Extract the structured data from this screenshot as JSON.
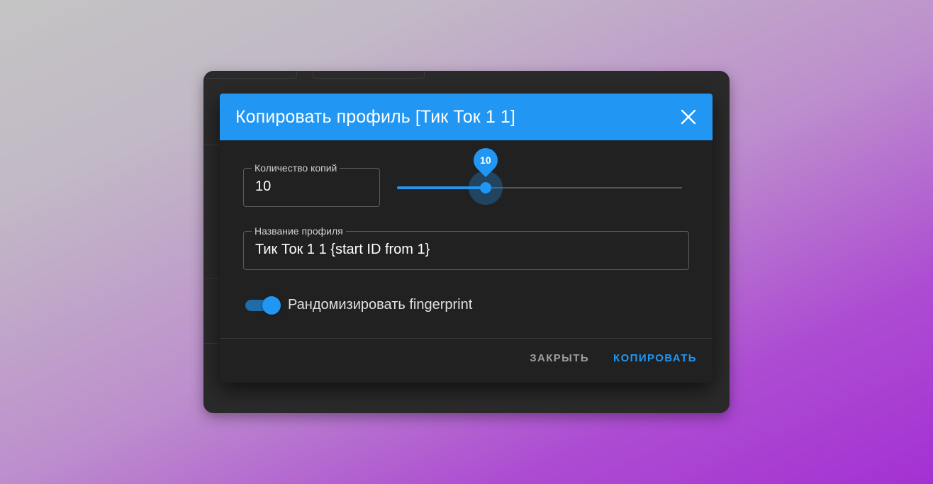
{
  "dialog": {
    "title": "Копировать профиль [Тик Ток 1 1]",
    "close_icon": "close-icon"
  },
  "copies": {
    "label": "Количество копий",
    "value": "10"
  },
  "slider": {
    "value": "10",
    "min": 1,
    "max": 33,
    "fraction": 0.31
  },
  "profile_name": {
    "label": "Название профиля",
    "value": "Тик Ток 1 1 {start ID from 1}"
  },
  "randomize": {
    "label": "Рандомизировать fingerprint",
    "checked": true
  },
  "actions": {
    "close_label": "ЗАКРЫТЬ",
    "copy_label": "КОПИРОВАТЬ"
  },
  "colors": {
    "accent": "#2196f3",
    "dialog_bg": "#212121",
    "window_bg": "#2a2a2a"
  }
}
